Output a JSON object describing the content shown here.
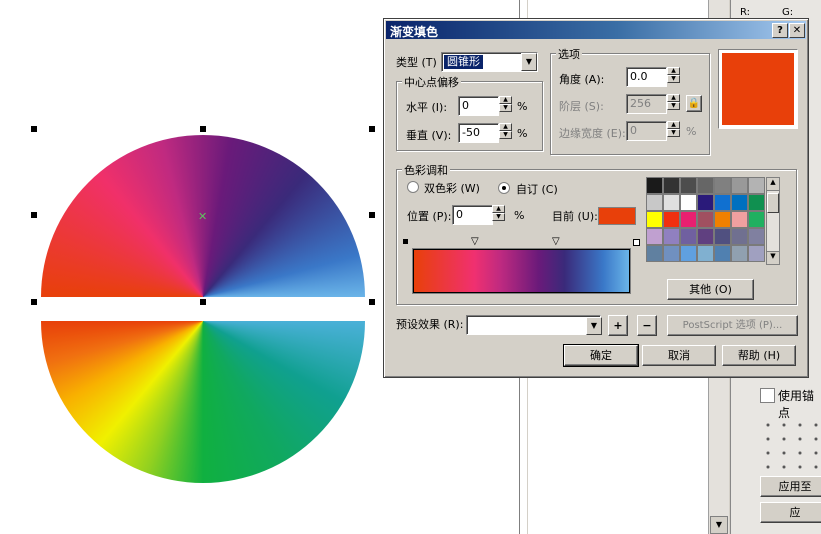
{
  "dialog": {
    "title": "渐变填色",
    "help_btn": "?",
    "close_btn": "✕",
    "type_label": "类型",
    "type_key": "(T)",
    "type_value": "圆锥形",
    "center_group": "中心点偏移",
    "horizontal_label": "水平",
    "horizontal_key": "(I):",
    "horizontal_value": "0",
    "vertical_label": "垂直",
    "vertical_key": "(V):",
    "vertical_value": "-50",
    "percent": "%",
    "options_group": "选项",
    "angle_label": "角度",
    "angle_key": "(A):",
    "angle_value": "0.0",
    "steps_label": "阶层",
    "steps_key": "(S):",
    "steps_value": "256",
    "edge_label": "边缘宽度",
    "edge_key": "(E):",
    "edge_value": "0",
    "color_group": "色彩调和",
    "two_color_label": "双色彩",
    "two_color_key": "(W)",
    "custom_label": "自订",
    "custom_key": "(C)",
    "position_label": "位置",
    "position_key": "(P):",
    "position_value": "0",
    "current_label": "目前",
    "current_key": "(U):",
    "current_color": "#e8400a",
    "others_btn": "其他",
    "others_key": "(O)",
    "preset_label": "预设效果",
    "preset_key": "(R):",
    "preset_value": "",
    "add_btn": "+",
    "remove_btn": "−",
    "postscript_btn": "PostScript 选项 (P)...",
    "ok_btn": "确定",
    "cancel_btn": "取消",
    "help_label": "帮助",
    "help_key": "(H)",
    "palette": [
      "#1a1a1a",
      "#333333",
      "#4d4d4d",
      "#666666",
      "#808080",
      "#999999",
      "#b3b3b3",
      "#c8c8c8",
      "#e0e0e0",
      "#ffffff",
      "#2a1a7a",
      "#1070d0",
      "#0070c0",
      "#109050",
      "#ffff00",
      "#f03010",
      "#e82070",
      "#a05060",
      "#f08000",
      "#f0a0a0",
      "#20b060",
      "#c0a0d0",
      "#9080c0",
      "#7060a0",
      "#604080",
      "#505080",
      "#707090",
      "#8080a0",
      "#6080a0",
      "#7090c0",
      "#60a0e0",
      "#80b0d0",
      "#5080b0",
      "#90a0b0",
      "#a0a0c0"
    ]
  },
  "right_panel": {
    "r_label": "R:",
    "g_label": "G:",
    "anchor_label": "使用锚点",
    "apply_label": "应用至",
    "apply2_label": "应"
  }
}
